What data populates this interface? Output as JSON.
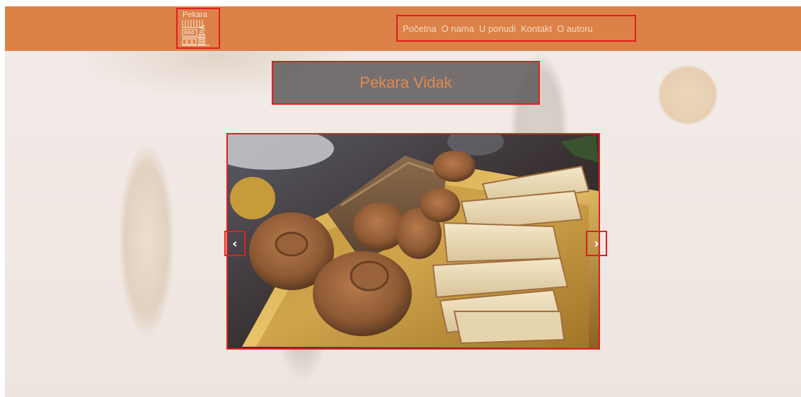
{
  "brand": {
    "logo_word_top": "Pekara",
    "logo_word_side": "Vidak",
    "accent_color": "#dc8148",
    "logo_icon": "bakery-storefront-icon"
  },
  "nav": {
    "items": [
      {
        "label": "Početna"
      },
      {
        "label": "O nama"
      },
      {
        "label": "U ponudi"
      },
      {
        "label": "Kontakt"
      },
      {
        "label": "O autoru"
      }
    ]
  },
  "hero": {
    "title": "Pekara Vidak"
  },
  "carousel": {
    "image_icon": "bread-platter-photo",
    "prev_label": "‹",
    "next_label": "›"
  }
}
